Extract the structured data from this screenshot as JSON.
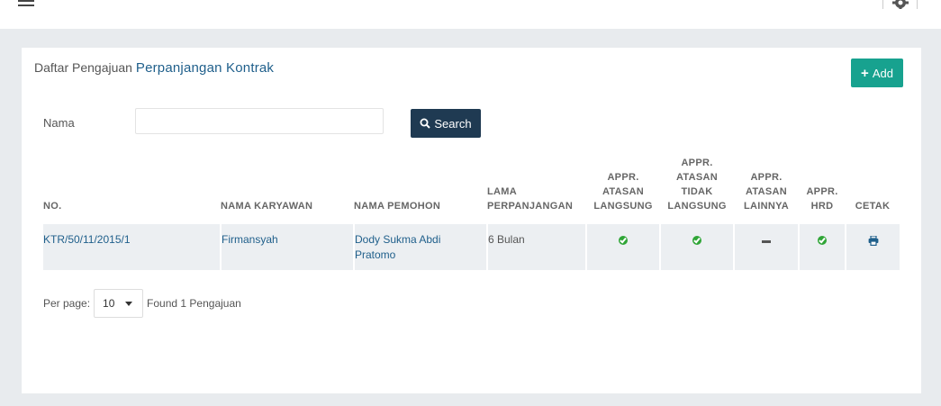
{
  "header": {
    "menu_icon": "hamburger-icon",
    "settings_icon": "gear-icon"
  },
  "panel": {
    "title_prefix": "Daftar Pengajuan",
    "title_highlight": "Perpanjangan Kontrak",
    "add_label": "Add",
    "add_icon": "plus-icon"
  },
  "filter": {
    "nama_label": "Nama",
    "nama_value": "",
    "search_label": "Search",
    "search_icon": "magnifier-icon"
  },
  "table": {
    "headers": {
      "no": "NO.",
      "nama_karyawan": "NAMA KARYAWAN",
      "nama_pemohon": "NAMA PEMOHON",
      "lama_1": "LAMA",
      "lama_2": "PERPANJANGAN",
      "appr_langsung_1": "APPR.",
      "appr_langsung_2": "ATASAN",
      "appr_langsung_3": "LANGSUNG",
      "appr_tidak_1": "APPR.",
      "appr_tidak_2": "ATASAN",
      "appr_tidak_3": "TIDAK",
      "appr_tidak_4": "LANGSUNG",
      "appr_lainnya_1": "APPR.",
      "appr_lainnya_2": "ATASAN",
      "appr_lainnya_3": "LAINNYA",
      "appr_hrd_1": "APPR.",
      "appr_hrd_2": "HRD",
      "cetak": "CETAK"
    },
    "rows": [
      {
        "no": "KTR/50/11/2015/1",
        "nama_karyawan": "Firmansyah",
        "nama_pemohon_1": "Dody Sukma Abdi",
        "nama_pemohon_2": "Pratomo",
        "lama": "6 Bulan",
        "appr_atasan_langsung": "approved",
        "appr_atasan_tidak_langsung": "approved",
        "appr_atasan_lainnya": "none",
        "appr_hrd": "approved",
        "cetak_icon": "printer-icon"
      }
    ]
  },
  "footer": {
    "per_page_label": "Per page:",
    "per_page_value": "10",
    "found_text": "Found 1 Pengajuan"
  },
  "colors": {
    "add_button": "#17a28f",
    "search_button": "#1f3a52",
    "link": "#1f5f8b",
    "approved": "#2fa537",
    "row_bg": "#eceff2",
    "page_bg": "#e8ebee"
  }
}
